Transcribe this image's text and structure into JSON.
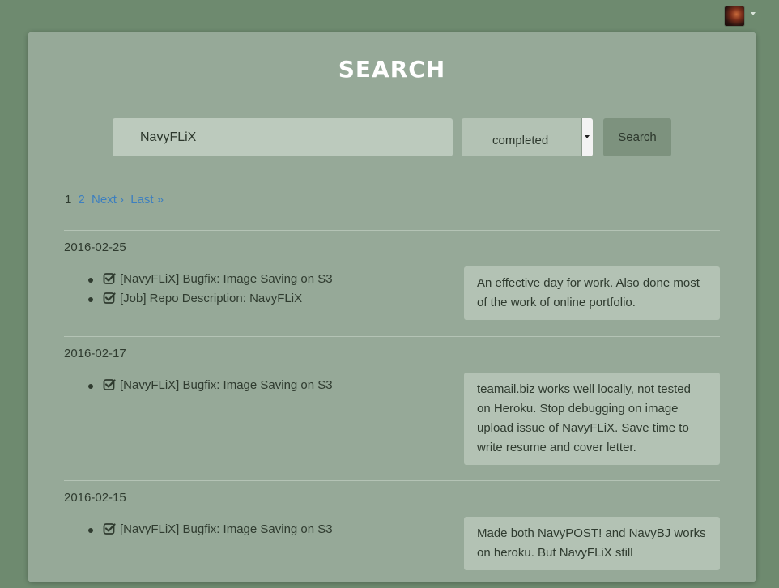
{
  "topbar": {
    "avatar_icon": "user-avatar",
    "caret_icon": "caret-down-icon"
  },
  "page": {
    "title": "SEARCH"
  },
  "search": {
    "query_value": "NavyFLiX",
    "status_selected": "completed",
    "button_label": "Search"
  },
  "pagination": {
    "current": "1",
    "page_2": "2",
    "next": "Next ›",
    "last": "Last »"
  },
  "entries": [
    {
      "date": "2016-02-25",
      "tasks": [
        "[NavyFLiX] Bugfix: Image Saving on S3",
        "[Job] Repo Description: NavyFLiX"
      ],
      "note": "An effective day for work. Also done most of the work of online portfolio."
    },
    {
      "date": "2016-02-17",
      "tasks": [
        "[NavyFLiX] Bugfix: Image Saving on S3"
      ],
      "note": "teamail.biz works well locally, not tested on Heroku. Stop debugging on image upload issue of NavyFLiX. Save time to write resume and cover letter."
    },
    {
      "date": "2016-02-15",
      "tasks": [
        "[NavyFLiX] Bugfix: Image Saving on S3"
      ],
      "note": "Made both NavyPOST! and NavyBJ works on heroku. But NavyFLiX still"
    }
  ],
  "colors": {
    "background": "#6e8a6f",
    "card": "#96a998",
    "link": "#3d7fbf",
    "title": "#ffffff"
  }
}
